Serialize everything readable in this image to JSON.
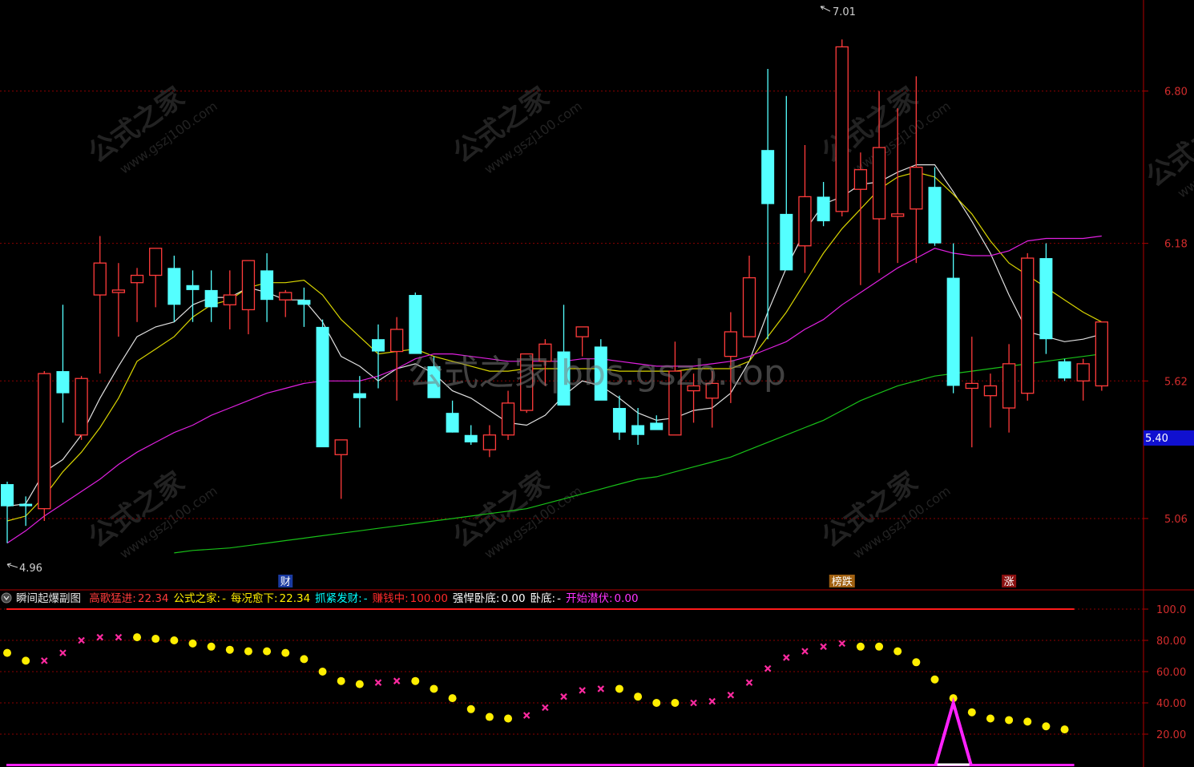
{
  "colors": {
    "background": "#000000",
    "grid": "#8b0000",
    "axis_line": "#b00000",
    "axis_text": "#d22c2c",
    "up_candle": "#ff3b3b",
    "down_candle": "#54ffff",
    "ma5": "#e0e0e0",
    "ma10": "#d8d400",
    "ma20": "#e020e0",
    "ma60": "#18c018",
    "dot_yellow": "#ffee00",
    "cross_magenta": "#ff2aa0",
    "spike": "#ff22ff",
    "ref_line_red": "#ff1a1a",
    "current_price_bg": "#1010d0"
  },
  "main_chart": {
    "type": "candlestick",
    "y_ticks": [
      "6.80",
      "6.18",
      "5.62",
      "5.06"
    ],
    "current_price_label": "5.40",
    "high_label": "7.01",
    "low_label": "4.96",
    "markers": [
      {
        "text": "财",
        "style": "blue",
        "bar": 15
      },
      {
        "text": "榜跌",
        "style": "orange",
        "bar": 45
      },
      {
        "text": "涨",
        "style": "red",
        "bar": 54
      }
    ],
    "watermarks": [
      "公式之家",
      "www.gszj100.com"
    ],
    "center_watermark": "公式之家|bbs.gszb.top"
  },
  "indicator": {
    "name": "瞬间起爆副图",
    "values": [
      {
        "label": "高歌猛进:",
        "value": "22.34",
        "color": "#ff3b3b"
      },
      {
        "label": "公式之家:",
        "value": "-",
        "color": "#ffee00"
      },
      {
        "label": "每况愈下:",
        "value": "22.34",
        "color": "#ffee00"
      },
      {
        "label": "抓紧发财:",
        "value": "-",
        "color": "#00ffff"
      },
      {
        "label": "赚钱中:",
        "value": "100.00",
        "color": "#ff2a2a"
      },
      {
        "label": "强悍卧底:",
        "value": "0.00",
        "color": "#ffffff"
      },
      {
        "label": "卧底:",
        "value": "-",
        "color": "#ffffff"
      },
      {
        "label": "开始潜伏:",
        "value": "0.00",
        "color": "#ff33ff"
      }
    ],
    "y_ticks": [
      "100.0",
      "80.00",
      "60.00",
      "40.00",
      "20.00"
    ]
  },
  "chart_data": [
    {
      "type": "candlestick",
      "ylim": [
        4.9,
        7.05
      ],
      "ohlc": [
        [
          5.2,
          5.21,
          4.96,
          5.11
        ],
        [
          5.12,
          5.15,
          5.03,
          5.11
        ],
        [
          5.1,
          5.66,
          5.05,
          5.65
        ],
        [
          5.66,
          5.93,
          5.45,
          5.57
        ],
        [
          5.4,
          5.64,
          5.38,
          5.63
        ],
        [
          5.97,
          6.21,
          5.65,
          6.1
        ],
        [
          5.98,
          6.1,
          5.8,
          5.99
        ],
        [
          6.02,
          6.08,
          5.86,
          6.05
        ],
        [
          6.05,
          6.1,
          5.92,
          6.16
        ],
        [
          6.08,
          6.13,
          5.86,
          5.93
        ],
        [
          6.01,
          6.07,
          5.86,
          5.99
        ],
        [
          5.99,
          6.07,
          5.86,
          5.92
        ],
        [
          5.93,
          6.07,
          5.83,
          5.97
        ],
        [
          5.91,
          6.02,
          5.81,
          6.11
        ],
        [
          6.07,
          6.14,
          5.86,
          5.95
        ],
        [
          5.95,
          5.99,
          5.88,
          5.98
        ],
        [
          5.95,
          6.0,
          5.84,
          5.93
        ],
        [
          5.84,
          5.87,
          5.37,
          5.35
        ],
        [
          5.32,
          5.38,
          5.14,
          5.38
        ],
        [
          5.57,
          5.64,
          5.43,
          5.55
        ],
        [
          5.79,
          5.85,
          5.59,
          5.74
        ],
        [
          5.74,
          5.88,
          5.54,
          5.83
        ],
        [
          5.97,
          5.98,
          5.75,
          5.73
        ],
        [
          5.68,
          5.72,
          5.58,
          5.55
        ],
        [
          5.49,
          5.54,
          5.41,
          5.41
        ],
        [
          5.4,
          5.44,
          5.36,
          5.37
        ],
        [
          5.34,
          5.44,
          5.31,
          5.4
        ],
        [
          5.4,
          5.58,
          5.38,
          5.53
        ],
        [
          5.5,
          5.73,
          5.49,
          5.73
        ],
        [
          5.7,
          5.79,
          5.6,
          5.77
        ],
        [
          5.74,
          5.93,
          5.55,
          5.52
        ],
        [
          5.8,
          5.84,
          5.72,
          5.84
        ],
        [
          5.76,
          5.79,
          5.58,
          5.54
        ],
        [
          5.51,
          5.56,
          5.38,
          5.41
        ],
        [
          5.44,
          5.51,
          5.36,
          5.4
        ],
        [
          5.45,
          5.48,
          5.43,
          5.42
        ],
        [
          5.4,
          5.78,
          5.41,
          5.66
        ],
        [
          5.58,
          5.65,
          5.45,
          5.6
        ],
        [
          5.55,
          5.66,
          5.43,
          5.61
        ],
        [
          5.72,
          5.9,
          5.53,
          5.82
        ],
        [
          5.8,
          6.13,
          5.8,
          6.04
        ],
        [
          6.56,
          6.89,
          5.79,
          6.34
        ],
        [
          6.3,
          6.78,
          6.29,
          6.07
        ],
        [
          6.17,
          6.58,
          6.06,
          6.37
        ],
        [
          6.37,
          6.43,
          6.25,
          6.27
        ],
        [
          6.31,
          7.01,
          6.29,
          6.98
        ],
        [
          6.4,
          6.55,
          6.01,
          6.48
        ],
        [
          6.28,
          6.8,
          6.06,
          6.57
        ],
        [
          6.29,
          6.73,
          6.1,
          6.3
        ],
        [
          6.32,
          6.86,
          6.1,
          6.49
        ],
        [
          6.41,
          6.49,
          6.17,
          6.18
        ],
        [
          6.04,
          6.18,
          5.57,
          5.6
        ],
        [
          5.59,
          5.8,
          5.35,
          5.61
        ],
        [
          5.56,
          5.65,
          5.43,
          5.6
        ],
        [
          5.51,
          5.77,
          5.41,
          5.69
        ],
        [
          5.57,
          6.14,
          5.54,
          6.12
        ],
        [
          6.12,
          6.18,
          5.73,
          5.79
        ],
        [
          5.7,
          5.71,
          5.62,
          5.63
        ],
        [
          5.62,
          5.71,
          5.54,
          5.69
        ],
        [
          5.6,
          5.83,
          5.58,
          5.86
        ]
      ],
      "series": [
        {
          "values": [
            5.11,
            5.12,
            5.25,
            5.3,
            5.4,
            5.55,
            5.68,
            5.8,
            5.84,
            5.86,
            5.93,
            5.96,
            5.96,
            6.0,
            5.98,
            5.95,
            5.95,
            5.86,
            5.72,
            5.68,
            5.62,
            5.67,
            5.69,
            5.65,
            5.58,
            5.55,
            5.5,
            5.45,
            5.44,
            5.48,
            5.56,
            5.62,
            5.6,
            5.55,
            5.49,
            5.46,
            5.47,
            5.5,
            5.51,
            5.57,
            5.7,
            5.9,
            6.08,
            6.23,
            6.34,
            6.37,
            6.42,
            6.43,
            6.47,
            6.5,
            6.5,
            6.39,
            6.27,
            6.14,
            5.97,
            5.82,
            5.8,
            5.78,
            5.79,
            5.81
          ]
        },
        {
          "values": [
            5.05,
            5.07,
            5.15,
            5.25,
            5.33,
            5.43,
            5.55,
            5.7,
            5.75,
            5.8,
            5.88,
            5.93,
            5.95,
            6.0,
            6.02,
            6.02,
            6.03,
            5.97,
            5.87,
            5.8,
            5.73,
            5.74,
            5.75,
            5.72,
            5.7,
            5.68,
            5.66,
            5.66,
            5.67,
            5.67,
            5.67,
            5.67,
            5.67,
            5.66,
            5.66,
            5.66,
            5.66,
            5.67,
            5.67,
            5.67,
            5.7,
            5.8,
            5.9,
            6.02,
            6.14,
            6.24,
            6.32,
            6.4,
            6.45,
            6.47,
            6.45,
            6.38,
            6.3,
            6.19,
            6.1,
            6.05,
            6.0,
            5.95,
            5.9,
            5.86
          ]
        },
        {
          "values": [
            4.96,
            5.01,
            5.07,
            5.12,
            5.17,
            5.22,
            5.28,
            5.33,
            5.37,
            5.41,
            5.44,
            5.48,
            5.51,
            5.54,
            5.57,
            5.59,
            5.61,
            5.62,
            5.62,
            5.62,
            5.64,
            5.67,
            5.71,
            5.73,
            5.73,
            5.72,
            5.71,
            5.7,
            5.7,
            5.7,
            5.7,
            5.71,
            5.71,
            5.7,
            5.69,
            5.68,
            5.68,
            5.68,
            5.69,
            5.7,
            5.72,
            5.75,
            5.78,
            5.83,
            5.87,
            5.93,
            5.98,
            6.03,
            6.08,
            6.12,
            6.16,
            6.14,
            6.13,
            6.13,
            6.15,
            6.19,
            6.2,
            6.2,
            6.2,
            6.21
          ]
        },
        {
          "values": [
            null,
            null,
            null,
            null,
            null,
            null,
            null,
            null,
            null,
            4.92,
            4.93,
            4.935,
            4.94,
            4.95,
            4.96,
            4.97,
            4.98,
            4.99,
            5.0,
            5.01,
            5.02,
            5.03,
            5.04,
            5.05,
            5.06,
            5.07,
            5.08,
            5.09,
            5.1,
            5.12,
            5.14,
            5.16,
            5.18,
            5.2,
            5.22,
            5.23,
            5.25,
            5.27,
            5.29,
            5.31,
            5.34,
            5.37,
            5.4,
            5.43,
            5.46,
            5.5,
            5.54,
            5.57,
            5.6,
            5.62,
            5.64,
            5.65,
            5.66,
            5.67,
            5.68,
            5.69,
            5.7,
            5.71,
            5.72,
            5.73
          ]
        }
      ]
    },
    {
      "type": "scatter",
      "ylim": [
        0,
        110
      ],
      "points": [
        {
          "y": 72,
          "marker": "dot"
        },
        {
          "y": 67,
          "marker": "dot"
        },
        {
          "y": 67,
          "marker": "cross"
        },
        {
          "y": 72,
          "marker": "cross"
        },
        {
          "y": 80,
          "marker": "cross"
        },
        {
          "y": 82,
          "marker": "cross"
        },
        {
          "y": 82,
          "marker": "cross"
        },
        {
          "y": 82,
          "marker": "dot"
        },
        {
          "y": 81,
          "marker": "dot"
        },
        {
          "y": 80,
          "marker": "dot"
        },
        {
          "y": 78,
          "marker": "dot"
        },
        {
          "y": 76,
          "marker": "dot"
        },
        {
          "y": 74,
          "marker": "dot"
        },
        {
          "y": 73,
          "marker": "dot"
        },
        {
          "y": 73,
          "marker": "dot"
        },
        {
          "y": 72,
          "marker": "dot"
        },
        {
          "y": 68,
          "marker": "dot"
        },
        {
          "y": 60,
          "marker": "dot"
        },
        {
          "y": 54,
          "marker": "dot"
        },
        {
          "y": 52,
          "marker": "dot"
        },
        {
          "y": 53,
          "marker": "cross"
        },
        {
          "y": 54,
          "marker": "cross"
        },
        {
          "y": 54,
          "marker": "dot"
        },
        {
          "y": 49,
          "marker": "dot"
        },
        {
          "y": 43,
          "marker": "dot"
        },
        {
          "y": 36,
          "marker": "dot"
        },
        {
          "y": 31,
          "marker": "dot"
        },
        {
          "y": 30,
          "marker": "dot"
        },
        {
          "y": 32,
          "marker": "cross"
        },
        {
          "y": 37,
          "marker": "cross"
        },
        {
          "y": 44,
          "marker": "cross"
        },
        {
          "y": 48,
          "marker": "cross"
        },
        {
          "y": 49,
          "marker": "cross"
        },
        {
          "y": 49,
          "marker": "dot"
        },
        {
          "y": 44,
          "marker": "dot"
        },
        {
          "y": 40,
          "marker": "dot"
        },
        {
          "y": 40,
          "marker": "dot"
        },
        {
          "y": 40,
          "marker": "cross"
        },
        {
          "y": 41,
          "marker": "cross"
        },
        {
          "y": 45,
          "marker": "cross"
        },
        {
          "y": 53,
          "marker": "cross"
        },
        {
          "y": 62,
          "marker": "cross"
        },
        {
          "y": 69,
          "marker": "cross"
        },
        {
          "y": 73,
          "marker": "cross"
        },
        {
          "y": 76,
          "marker": "cross"
        },
        {
          "y": 78,
          "marker": "cross"
        },
        {
          "y": 76,
          "marker": "dot"
        },
        {
          "y": 76,
          "marker": "dot"
        },
        {
          "y": 73,
          "marker": "dot"
        },
        {
          "y": 66,
          "marker": "dot"
        },
        {
          "y": 55,
          "marker": "dot"
        },
        {
          "y": 43,
          "marker": "dot"
        },
        {
          "y": 34,
          "marker": "dot"
        },
        {
          "y": 30,
          "marker": "dot"
        },
        {
          "y": 29,
          "marker": "dot"
        },
        {
          "y": 28,
          "marker": "dot"
        },
        {
          "y": 25,
          "marker": "dot"
        },
        {
          "y": 23,
          "marker": "dot"
        }
      ],
      "reference_lines": [
        100,
        0
      ],
      "spike": {
        "bar": 51,
        "value": 40
      }
    }
  ]
}
